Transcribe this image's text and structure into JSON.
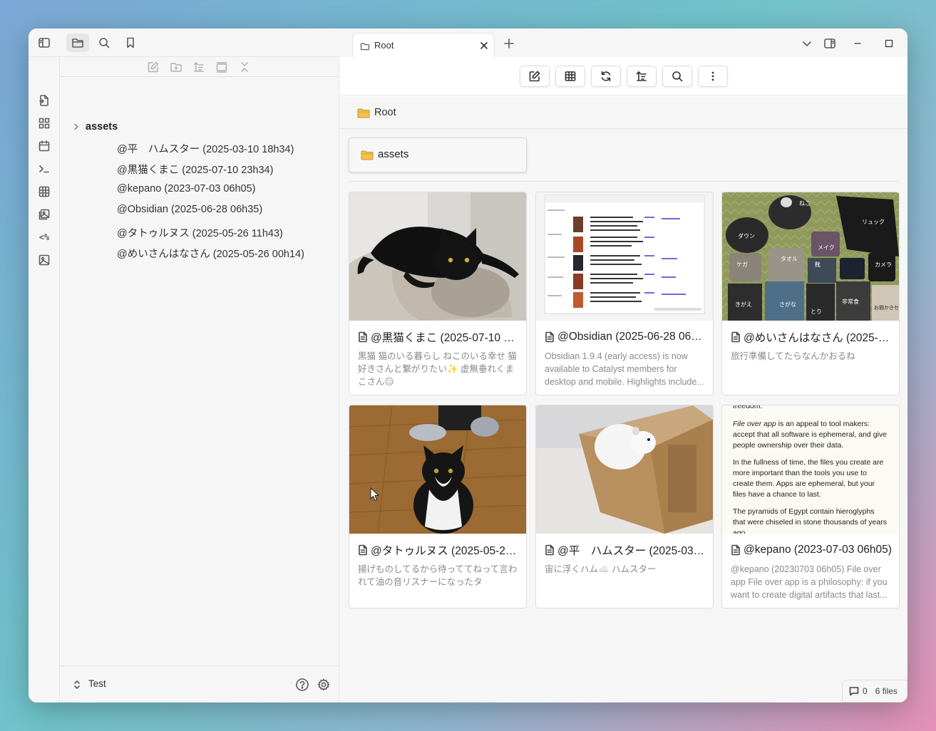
{
  "left_toolbar": {
    "icons": [
      "sidebar-toggle-icon",
      "folder-icon",
      "search-icon",
      "bookmark-icon"
    ]
  },
  "ribbon": {
    "icons": [
      "open-note-icon",
      "blocks-icon",
      "calendar-icon",
      "terminal-icon",
      "table-icon",
      "gallery-icon",
      "templater-icon",
      "image-icon"
    ],
    "templater_text": "<%"
  },
  "file_explorer": {
    "folder": "assets",
    "files": [
      "@平　ハムスター (2025-03-10 18h34)",
      "@黒猫くまこ (2025-07-10 23h34)",
      "@kepano (2023-07-03 06h05)",
      "@Obsidian (2025-06-28 06h35)",
      "@タトゥルヌス (2025-05-26 11h43)",
      "@めいさんはなさん (2025-05-26 00h14)"
    ]
  },
  "vault": {
    "name": "Test"
  },
  "tab": {
    "label": "Root"
  },
  "breadcrumb": {
    "label": "Root"
  },
  "folder_card": {
    "label": "assets"
  },
  "cards": [
    {
      "title": "@黒猫くまこ (2025-07-10 23h34)",
      "desc": "黒猫 猫のいる暮らし ねこのいる幸せ 猫好きさんと繋がりたい✨ 虚無垂れくまこさん😑"
    },
    {
      "title": "@Obsidian (2025-06-28 06h35)",
      "desc": "Obsidian 1.9.4 (early access) is now available to Catalyst members for desktop and mobile. Highlights include..."
    },
    {
      "title": "@めいさんはなさん (2025-05-26 00h14)",
      "desc": "旅行準備してたらなんかおるね"
    },
    {
      "title": "@タトゥルヌス (2025-05-26 11h43)",
      "desc": "揚げものしてるから待っててねって言われて油の音リスナーになったタ"
    },
    {
      "title": "@平　ハムスター (2025-03-10 18h34)",
      "desc": "宙に浮くハム☁️ ハムスター"
    },
    {
      "title": "@kepano (2023-07-03 06h05)",
      "desc": "@kepano (20230703 06h05) File over app File over app is a philosophy: if you want to create digital artifacts that last..."
    }
  ],
  "kepano_snippet": {
    "top": "freedom.",
    "p1_em": "File over app",
    "p1_rest": " is an appeal to tool makers: accept that all software is ephemeral, and give people ownership over their data.",
    "p2": "In the fullness of time, the files you create are more important than the tools you use to create them. Apps are ephemeral, but your files have a chance to last.",
    "p3": "The pyramids of Egypt contain hieroglyphs that were chiseled in stone thousands of years ago."
  },
  "bag_labels": [
    "ねこ",
    "リュック",
    "ダウン",
    "メイク",
    "ケガ",
    "タオル",
    "靴",
    "カメラ",
    "きがえ",
    "さがな",
    "非常食",
    "お揃かきセット",
    "とり"
  ],
  "status_bar": {
    "comments": "0",
    "files": "6 files"
  }
}
